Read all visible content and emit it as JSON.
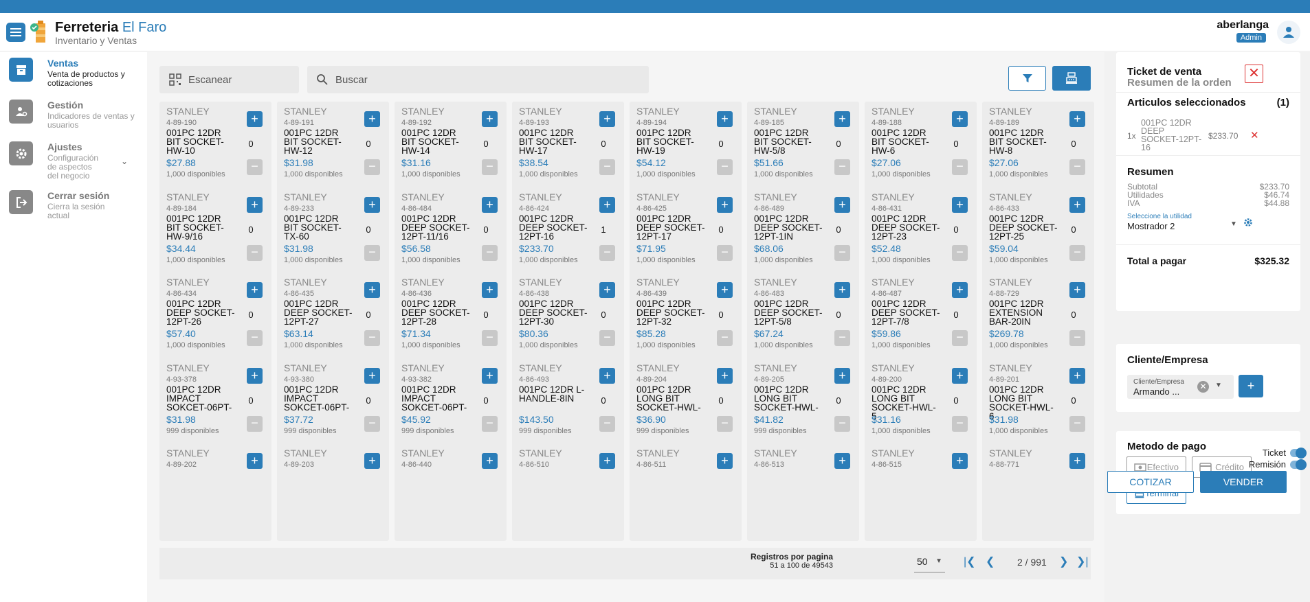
{
  "app": {
    "brand_main": "Ferreteria",
    "brand_accent": "El Faro",
    "subtitle": "Inventario y Ventas",
    "user": "aberlanga",
    "role": "Admin",
    "accent_color": "#2b7db8"
  },
  "sidebar": {
    "items": [
      {
        "title": "Ventas",
        "desc": "Venta de productos y cotizaciones",
        "icon": "archive-icon",
        "active": true
      },
      {
        "title": "Gestión",
        "desc": "Indicadores de ventas y usuarios",
        "icon": "user-gear-icon",
        "active": false
      },
      {
        "title": "Ajustes",
        "desc": "Configuración de aspectos del negocio",
        "icon": "gear-icon",
        "active": false
      },
      {
        "title": "Cerrar sesión",
        "desc": "Cierra la sesión actual",
        "icon": "logout-icon",
        "active": false
      }
    ]
  },
  "toolbar": {
    "scan_placeholder": "Escanear",
    "search_placeholder": "Buscar"
  },
  "products": [
    {
      "brand": "STANLEY",
      "sku": "4-89-190",
      "name": "001PC 12DR BIT SOCKET-HW-10",
      "qty": "0",
      "price": "$27.88",
      "avail": "1,000 disponibles"
    },
    {
      "brand": "STANLEY",
      "sku": "4-89-191",
      "name": "001PC 12DR BIT SOCKET-HW-12",
      "qty": "0",
      "price": "$31.98",
      "avail": "1,000 disponibles"
    },
    {
      "brand": "STANLEY",
      "sku": "4-89-192",
      "name": "001PC 12DR BIT SOCKET-HW-14",
      "qty": "0",
      "price": "$31.16",
      "avail": "1,000 disponibles"
    },
    {
      "brand": "STANLEY",
      "sku": "4-89-193",
      "name": "001PC 12DR BIT SOCKET-HW-17",
      "qty": "0",
      "price": "$38.54",
      "avail": "1,000 disponibles"
    },
    {
      "brand": "STANLEY",
      "sku": "4-89-194",
      "name": "001PC 12DR BIT SOCKET-HW-19",
      "qty": "0",
      "price": "$54.12",
      "avail": "1,000 disponibles"
    },
    {
      "brand": "STANLEY",
      "sku": "4-89-185",
      "name": "001PC 12DR BIT SOCKET-HW-5/8",
      "qty": "0",
      "price": "$51.66",
      "avail": "1,000 disponibles"
    },
    {
      "brand": "STANLEY",
      "sku": "4-89-188",
      "name": "001PC 12DR BIT SOCKET-HW-6",
      "qty": "0",
      "price": "$27.06",
      "avail": "1,000 disponibles"
    },
    {
      "brand": "STANLEY",
      "sku": "4-89-189",
      "name": "001PC 12DR BIT SOCKET-HW-8",
      "qty": "0",
      "price": "$27.06",
      "avail": "1,000 disponibles"
    },
    {
      "brand": "STANLEY",
      "sku": "4-89-184",
      "name": "001PC 12DR BIT SOCKET-HW-9/16",
      "qty": "0",
      "price": "$34.44",
      "avail": "1,000 disponibles"
    },
    {
      "brand": "STANLEY",
      "sku": "4-89-233",
      "name": "001PC 12DR BIT SOCKET-TX-60",
      "qty": "0",
      "price": "$31.98",
      "avail": "1,000 disponibles"
    },
    {
      "brand": "STANLEY",
      "sku": "4-86-484",
      "name": "001PC 12DR DEEP SOCKET-12PT-11/16",
      "qty": "0",
      "price": "$56.58",
      "avail": "1,000 disponibles"
    },
    {
      "brand": "STANLEY",
      "sku": "4-86-424",
      "name": "001PC 12DR DEEP SOCKET-12PT-16",
      "qty": "1",
      "price": "$233.70",
      "avail": "1,000 disponibles"
    },
    {
      "brand": "STANLEY",
      "sku": "4-86-425",
      "name": "001PC 12DR DEEP SOCKET-12PT-17",
      "qty": "0",
      "price": "$71.95",
      "avail": "1,000 disponibles"
    },
    {
      "brand": "STANLEY",
      "sku": "4-86-489",
      "name": "001PC 12DR DEEP SOCKET-12PT-1IN",
      "qty": "0",
      "price": "$68.06",
      "avail": "1,000 disponibles"
    },
    {
      "brand": "STANLEY",
      "sku": "4-86-431",
      "name": "001PC 12DR DEEP SOCKET-12PT-23",
      "qty": "0",
      "price": "$52.48",
      "avail": "1,000 disponibles"
    },
    {
      "brand": "STANLEY",
      "sku": "4-86-433",
      "name": "001PC 12DR DEEP SOCKET-12PT-25",
      "qty": "0",
      "price": "$59.04",
      "avail": "1,000 disponibles"
    },
    {
      "brand": "STANLEY",
      "sku": "4-86-434",
      "name": "001PC 12DR DEEP SOCKET-12PT-26",
      "qty": "0",
      "price": "$57.40",
      "avail": "1,000 disponibles"
    },
    {
      "brand": "STANLEY",
      "sku": "4-86-435",
      "name": "001PC 12DR DEEP SOCKET-12PT-27",
      "qty": "0",
      "price": "$63.14",
      "avail": "1,000 disponibles"
    },
    {
      "brand": "STANLEY",
      "sku": "4-86-436",
      "name": "001PC 12DR DEEP SOCKET-12PT-28",
      "qty": "0",
      "price": "$71.34",
      "avail": "1,000 disponibles"
    },
    {
      "brand": "STANLEY",
      "sku": "4-86-438",
      "name": "001PC 12DR DEEP SOCKET-12PT-30",
      "qty": "0",
      "price": "$80.36",
      "avail": "1,000 disponibles"
    },
    {
      "brand": "STANLEY",
      "sku": "4-86-439",
      "name": "001PC 12DR DEEP SOCKET-12PT-32",
      "qty": "0",
      "price": "$85.28",
      "avail": "1,000 disponibles"
    },
    {
      "brand": "STANLEY",
      "sku": "4-86-483",
      "name": "001PC 12DR DEEP SOCKET-12PT-5/8",
      "qty": "0",
      "price": "$67.24",
      "avail": "1,000 disponibles"
    },
    {
      "brand": "STANLEY",
      "sku": "4-86-487",
      "name": "001PC 12DR DEEP SOCKET-12PT-7/8",
      "qty": "0",
      "price": "$59.86",
      "avail": "1,000 disponibles"
    },
    {
      "brand": "STANLEY",
      "sku": "4-88-729",
      "name": "001PC 12DR EXTENSION BAR-20IN",
      "qty": "0",
      "price": "$269.78",
      "avail": "1,000 disponibles"
    },
    {
      "brand": "STANLEY",
      "sku": "4-93-378",
      "name": "001PC 12DR IMPACT SOKCET-06PT-",
      "qty": "0",
      "price": "$31.98",
      "avail": "999 disponibles"
    },
    {
      "brand": "STANLEY",
      "sku": "4-93-380",
      "name": "001PC 12DR IMPACT SOKCET-06PT-",
      "qty": "0",
      "price": "$37.72",
      "avail": "999 disponibles"
    },
    {
      "brand": "STANLEY",
      "sku": "4-93-382",
      "name": "001PC 12DR IMPACT SOKCET-06PT-",
      "qty": "0",
      "price": "$45.92",
      "avail": "999 disponibles"
    },
    {
      "brand": "STANLEY",
      "sku": "4-86-493",
      "name": "001PC 12DR L-HANDLE-8IN",
      "qty": "0",
      "price": "$143.50",
      "avail": "999 disponibles"
    },
    {
      "brand": "STANLEY",
      "sku": "4-89-204",
      "name": "001PC 12DR LONG BIT SOCKET-HWL-",
      "qty": "0",
      "price": "$36.90",
      "avail": "999 disponibles"
    },
    {
      "brand": "STANLEY",
      "sku": "4-89-205",
      "name": "001PC 12DR LONG BIT SOCKET-HWL-",
      "qty": "0",
      "price": "$41.82",
      "avail": "999 disponibles"
    },
    {
      "brand": "STANLEY",
      "sku": "4-89-200",
      "name": "001PC 12DR LONG BIT SOCKET-HWL-5",
      "qty": "0",
      "price": "$31.16",
      "avail": "1,000 disponibles"
    },
    {
      "brand": "STANLEY",
      "sku": "4-89-201",
      "name": "001PC 12DR LONG BIT SOCKET-HWL-6",
      "qty": "0",
      "price": "$31.98",
      "avail": "1,000 disponibles"
    },
    {
      "brand": "STANLEY",
      "sku": "4-89-202",
      "name": "",
      "qty": "",
      "price": "",
      "avail": ""
    },
    {
      "brand": "STANLEY",
      "sku": "4-89-203",
      "name": "",
      "qty": "",
      "price": "",
      "avail": ""
    },
    {
      "brand": "STANLEY",
      "sku": "4-86-440",
      "name": "",
      "qty": "",
      "price": "",
      "avail": ""
    },
    {
      "brand": "STANLEY",
      "sku": "4-86-510",
      "name": "",
      "qty": "",
      "price": "",
      "avail": ""
    },
    {
      "brand": "STANLEY",
      "sku": "4-86-511",
      "name": "",
      "qty": "",
      "price": "",
      "avail": ""
    },
    {
      "brand": "STANLEY",
      "sku": "4-86-513",
      "name": "",
      "qty": "",
      "price": "",
      "avail": ""
    },
    {
      "brand": "STANLEY",
      "sku": "4-86-515",
      "name": "",
      "qty": "",
      "price": "",
      "avail": ""
    },
    {
      "brand": "STANLEY",
      "sku": "4-88-771",
      "name": "",
      "qty": "",
      "price": "",
      "avail": ""
    }
  ],
  "pager": {
    "label": "Registros por pagina",
    "range": "51 a 100 de 49543",
    "page_size": "50",
    "page": "2 / 991"
  },
  "ticket": {
    "title": "Ticket de venta",
    "subtitle": "Resumen de la orden",
    "selected_label": "Articulos seleccionados",
    "selected_count": "(1)",
    "items": [
      {
        "qty": "1x",
        "name": "001PC 12DR DEEP SOCKET-12PT-16",
        "price": "$233.70"
      }
    ],
    "summary_title": "Resumen",
    "subtotal_label": "Subtotal",
    "subtotal": "$233.70",
    "util_label": "Utilidades",
    "util": "$46.74",
    "iva_label": "IVA",
    "iva": "$44.88",
    "util_select_label": "Seleccione la utilidad",
    "util_select_value": "Mostrador 2",
    "total_label": "Total a pagar",
    "total": "$325.32"
  },
  "client": {
    "title": "Cliente/Empresa",
    "field_label": "Cliente/Empresa",
    "value": "Armando ..."
  },
  "payment": {
    "title": "Metodo de pago",
    "cash": "Efectivo",
    "credit": "Crédito",
    "terminal": "Terminal"
  },
  "toggles": {
    "ticket": "Ticket",
    "remision": "Remisión"
  },
  "actions": {
    "quote": "COTIZAR",
    "sell": "VENDER"
  }
}
